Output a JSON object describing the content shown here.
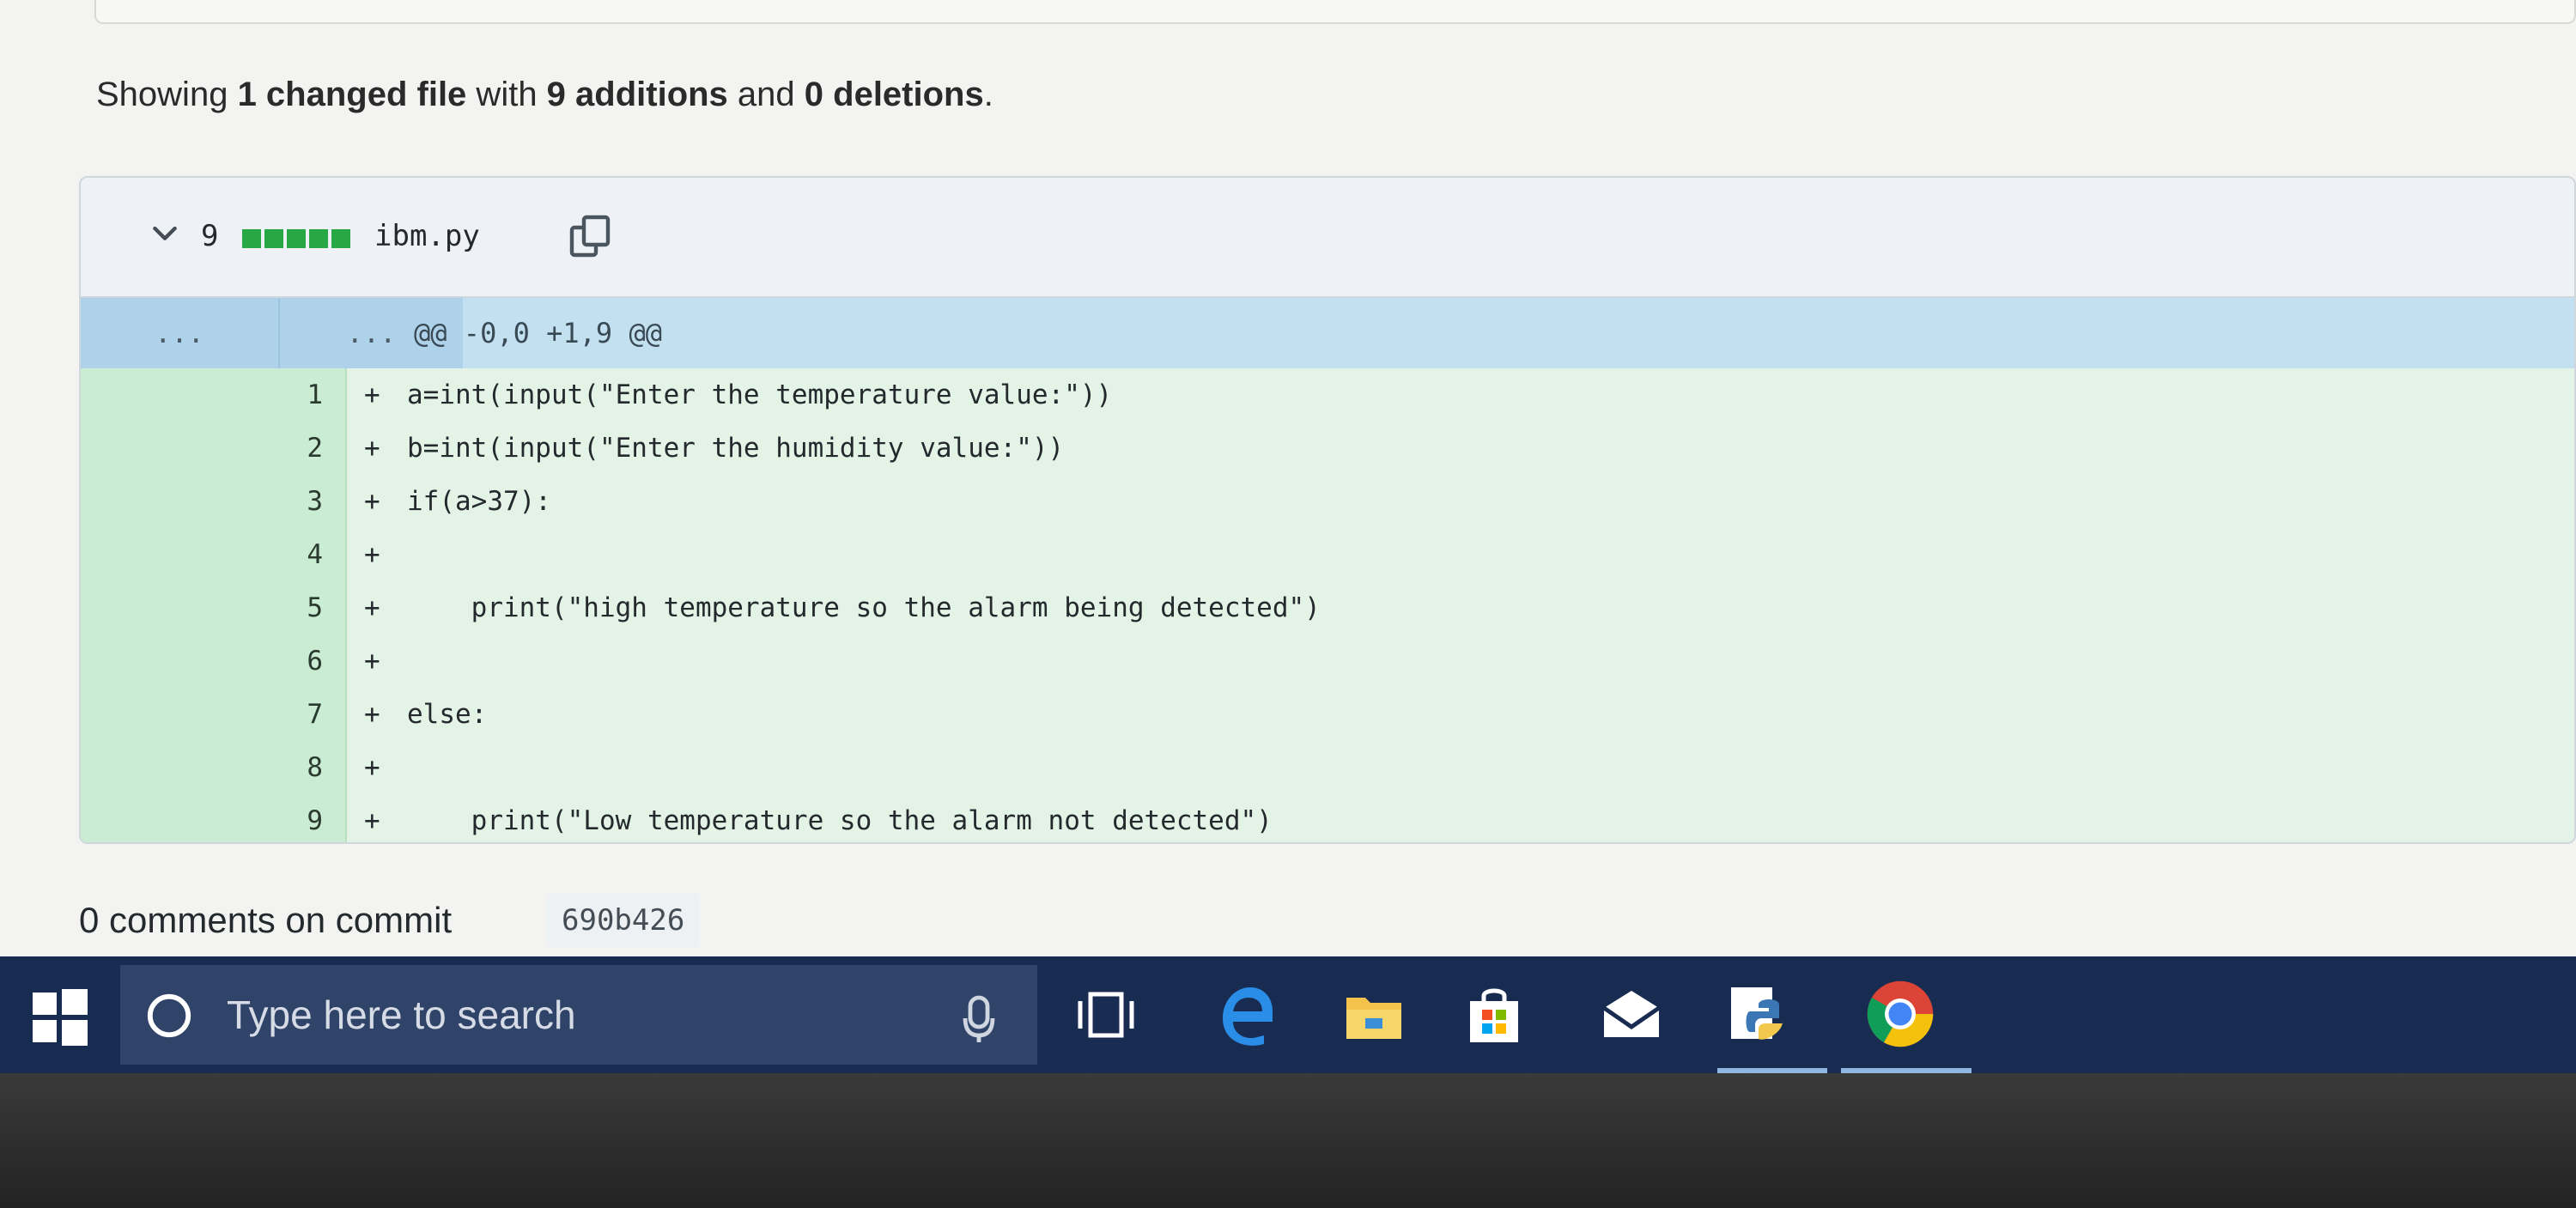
{
  "summary": {
    "prefix": "Showing ",
    "changed_files": "1 changed file",
    "with": " with ",
    "additions": "9 additions",
    "and": " and ",
    "deletions": "0 deletions",
    "suffix": "."
  },
  "file": {
    "addition_count": "9",
    "name": "ibm.py",
    "icons": {
      "collapse": "chevron-down-icon",
      "copy": "copy-icon"
    },
    "diffstat_color": "#28a745",
    "hunk": {
      "old_num": "...",
      "new_num": "...",
      "header": "@@ -0,0 +1,9 @@"
    },
    "lines": [
      {
        "num": "1",
        "sign": "+",
        "code": "a=int(input(\"Enter the temperature value:\"))"
      },
      {
        "num": "2",
        "sign": "+",
        "code": "b=int(input(\"Enter the humidity value:\"))"
      },
      {
        "num": "3",
        "sign": "+",
        "code": "if(a>37):"
      },
      {
        "num": "4",
        "sign": "+",
        "code": ""
      },
      {
        "num": "5",
        "sign": "+",
        "code": "    print(\"high temperature so the alarm being detected\")"
      },
      {
        "num": "6",
        "sign": "+",
        "code": ""
      },
      {
        "num": "7",
        "sign": "+",
        "code": "else:"
      },
      {
        "num": "8",
        "sign": "+",
        "code": ""
      },
      {
        "num": "9",
        "sign": "+",
        "code": "    print(\"Low temperature so the alarm not detected\")"
      }
    ]
  },
  "comments": {
    "heading": "0 comments on commit",
    "sha": "690b426"
  },
  "taskbar": {
    "search_placeholder": "Type here to search",
    "apps": [
      "windows-start-icon",
      "cortana-icon",
      "microphone-icon",
      "task-view-icon",
      "edge-icon",
      "file-explorer-icon",
      "store-icon",
      "mail-icon",
      "python-idle-icon",
      "chrome-icon"
    ],
    "background": "#182c52"
  }
}
